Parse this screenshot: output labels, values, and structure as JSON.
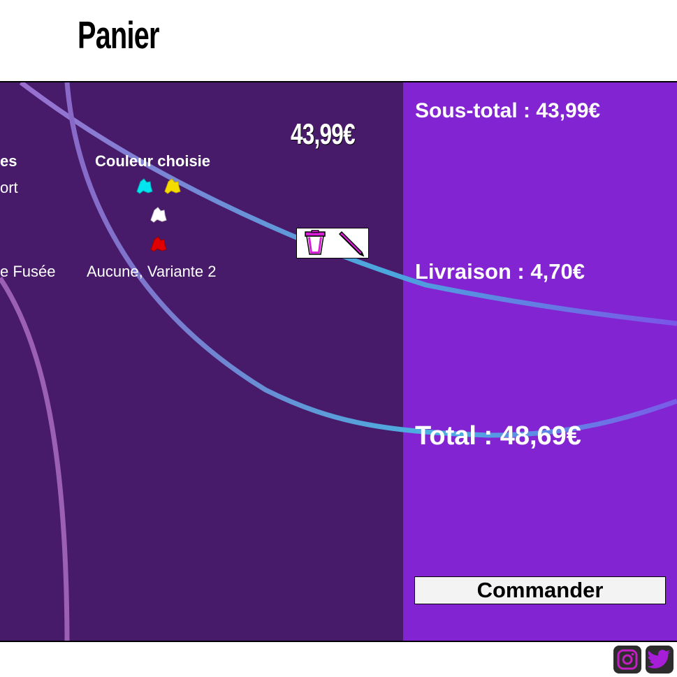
{
  "header": {
    "title": "Panier"
  },
  "cart": {
    "item_price": "43,99€",
    "columns": {
      "partial": "es",
      "color": "Couleur choisie"
    },
    "row": {
      "partial_value_1": "ort",
      "partial_value_2": "e Fusée",
      "color_options": "Aucune, Variante 2"
    },
    "swatches": [
      {
        "name": "cyan",
        "color": "#00e5f0"
      },
      {
        "name": "yellow",
        "color": "#f5dc00"
      },
      {
        "name": "white",
        "color": "#ffffff"
      },
      {
        "name": "red",
        "color": "#e00000"
      }
    ],
    "actions": {
      "delete_icon": "trash-icon",
      "edit_icon": "pencil-icon"
    }
  },
  "summary": {
    "subtotal": "Sous-total : 43,99€",
    "shipping": "Livraison : 4,70€",
    "total": "Total : 48,69€",
    "order_button": "Commander"
  },
  "footer": {
    "social": [
      "instagram-icon",
      "twitter-icon"
    ]
  },
  "colors": {
    "cart_bg": "#471b69",
    "summary_bg": "#8324d3",
    "accent": "#d81fd8"
  }
}
